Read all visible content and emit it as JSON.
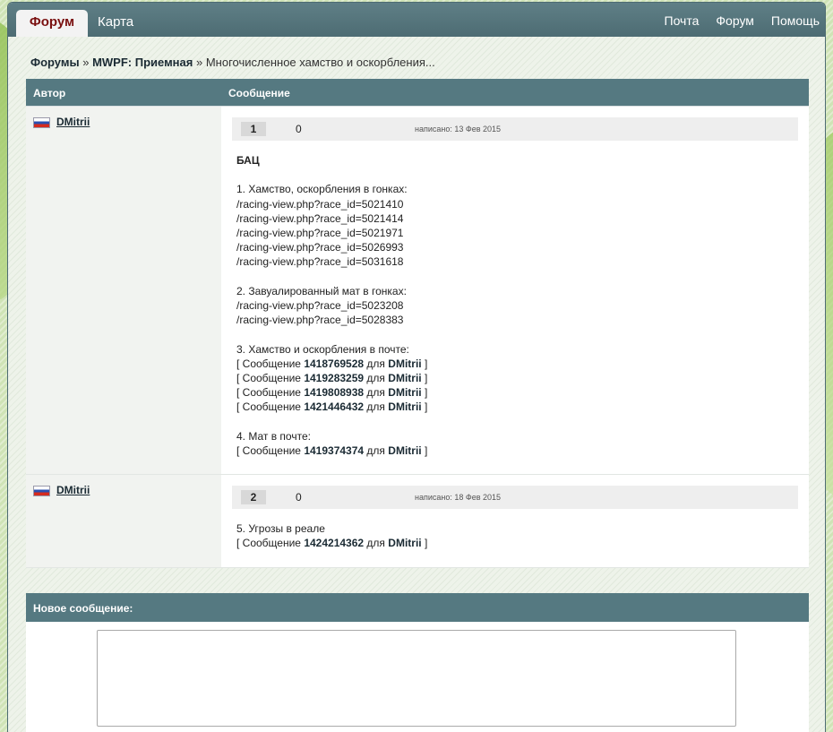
{
  "nav": {
    "tabs": [
      {
        "label": "Форум",
        "active": true
      },
      {
        "label": "Карта",
        "active": false
      }
    ],
    "links": [
      "Почта",
      "Форум",
      "Помощь"
    ]
  },
  "breadcrumb": {
    "root": "Форумы",
    "sep1": "»",
    "forum": "MWPF: Приемная",
    "sep2": "»",
    "topic": "Многочисленное хамство и оскорбления..."
  },
  "table": {
    "author_header": "Автор",
    "message_header": "Сообщение"
  },
  "posts": [
    {
      "author": "DMitrii",
      "number": "1",
      "rating": "0",
      "date": "написано: 13 Фев 2015",
      "lines": [
        {
          "text": "БАЦ",
          "bold": true
        },
        {
          "text": ""
        },
        {
          "text": "1. Хамство, оскорбления в гонках:"
        },
        {
          "text": "/racing-view.php?race_id=5021410"
        },
        {
          "text": "/racing-view.php?race_id=5021414"
        },
        {
          "text": "/racing-view.php?race_id=5021971"
        },
        {
          "text": "/racing-view.php?race_id=5026993"
        },
        {
          "text": "/racing-view.php?race_id=5031618"
        },
        {
          "text": ""
        },
        {
          "text": "2. Завуалированный мат в гонках:"
        },
        {
          "text": "/racing-view.php?race_id=5023208"
        },
        {
          "text": "/racing-view.php?race_id=5028383"
        },
        {
          "text": ""
        },
        {
          "text": "3. Хамство и оскорбления в почте:"
        },
        {
          "ref": {
            "open": "[ Сообщение",
            "id": "1418769528",
            "for": "для",
            "user": "DMitrii",
            "close": "]"
          }
        },
        {
          "ref": {
            "open": "[ Сообщение",
            "id": "1419283259",
            "for": "для",
            "user": "DMitrii",
            "close": "]"
          }
        },
        {
          "ref": {
            "open": "[ Сообщение",
            "id": "1419808938",
            "for": "для",
            "user": "DMitrii",
            "close": "]"
          }
        },
        {
          "ref": {
            "open": "[ Сообщение",
            "id": "1421446432",
            "for": "для",
            "user": "DMitrii",
            "close": "]"
          }
        },
        {
          "text": ""
        },
        {
          "text": "4. Мат в почте:"
        },
        {
          "ref": {
            "open": "[ Сообщение",
            "id": "1419374374",
            "for": "для",
            "user": "DMitrii",
            "close": "]"
          }
        }
      ]
    },
    {
      "author": "DMitrii",
      "number": "2",
      "rating": "0",
      "date": "написано: 18 Фев 2015",
      "lines": [
        {
          "text": "5. Угрозы в реале"
        },
        {
          "ref": {
            "open": "[ Сообщение",
            "id": "1424214362",
            "for": "для",
            "user": "DMitrii",
            "close": "]"
          }
        }
      ]
    }
  ],
  "new_message": {
    "title": "Новое сообщение:",
    "value": ""
  },
  "colors": {
    "header_bg": "#557981",
    "active_tab_text": "#7a1010",
    "page_bg": "#cfe3b6"
  }
}
